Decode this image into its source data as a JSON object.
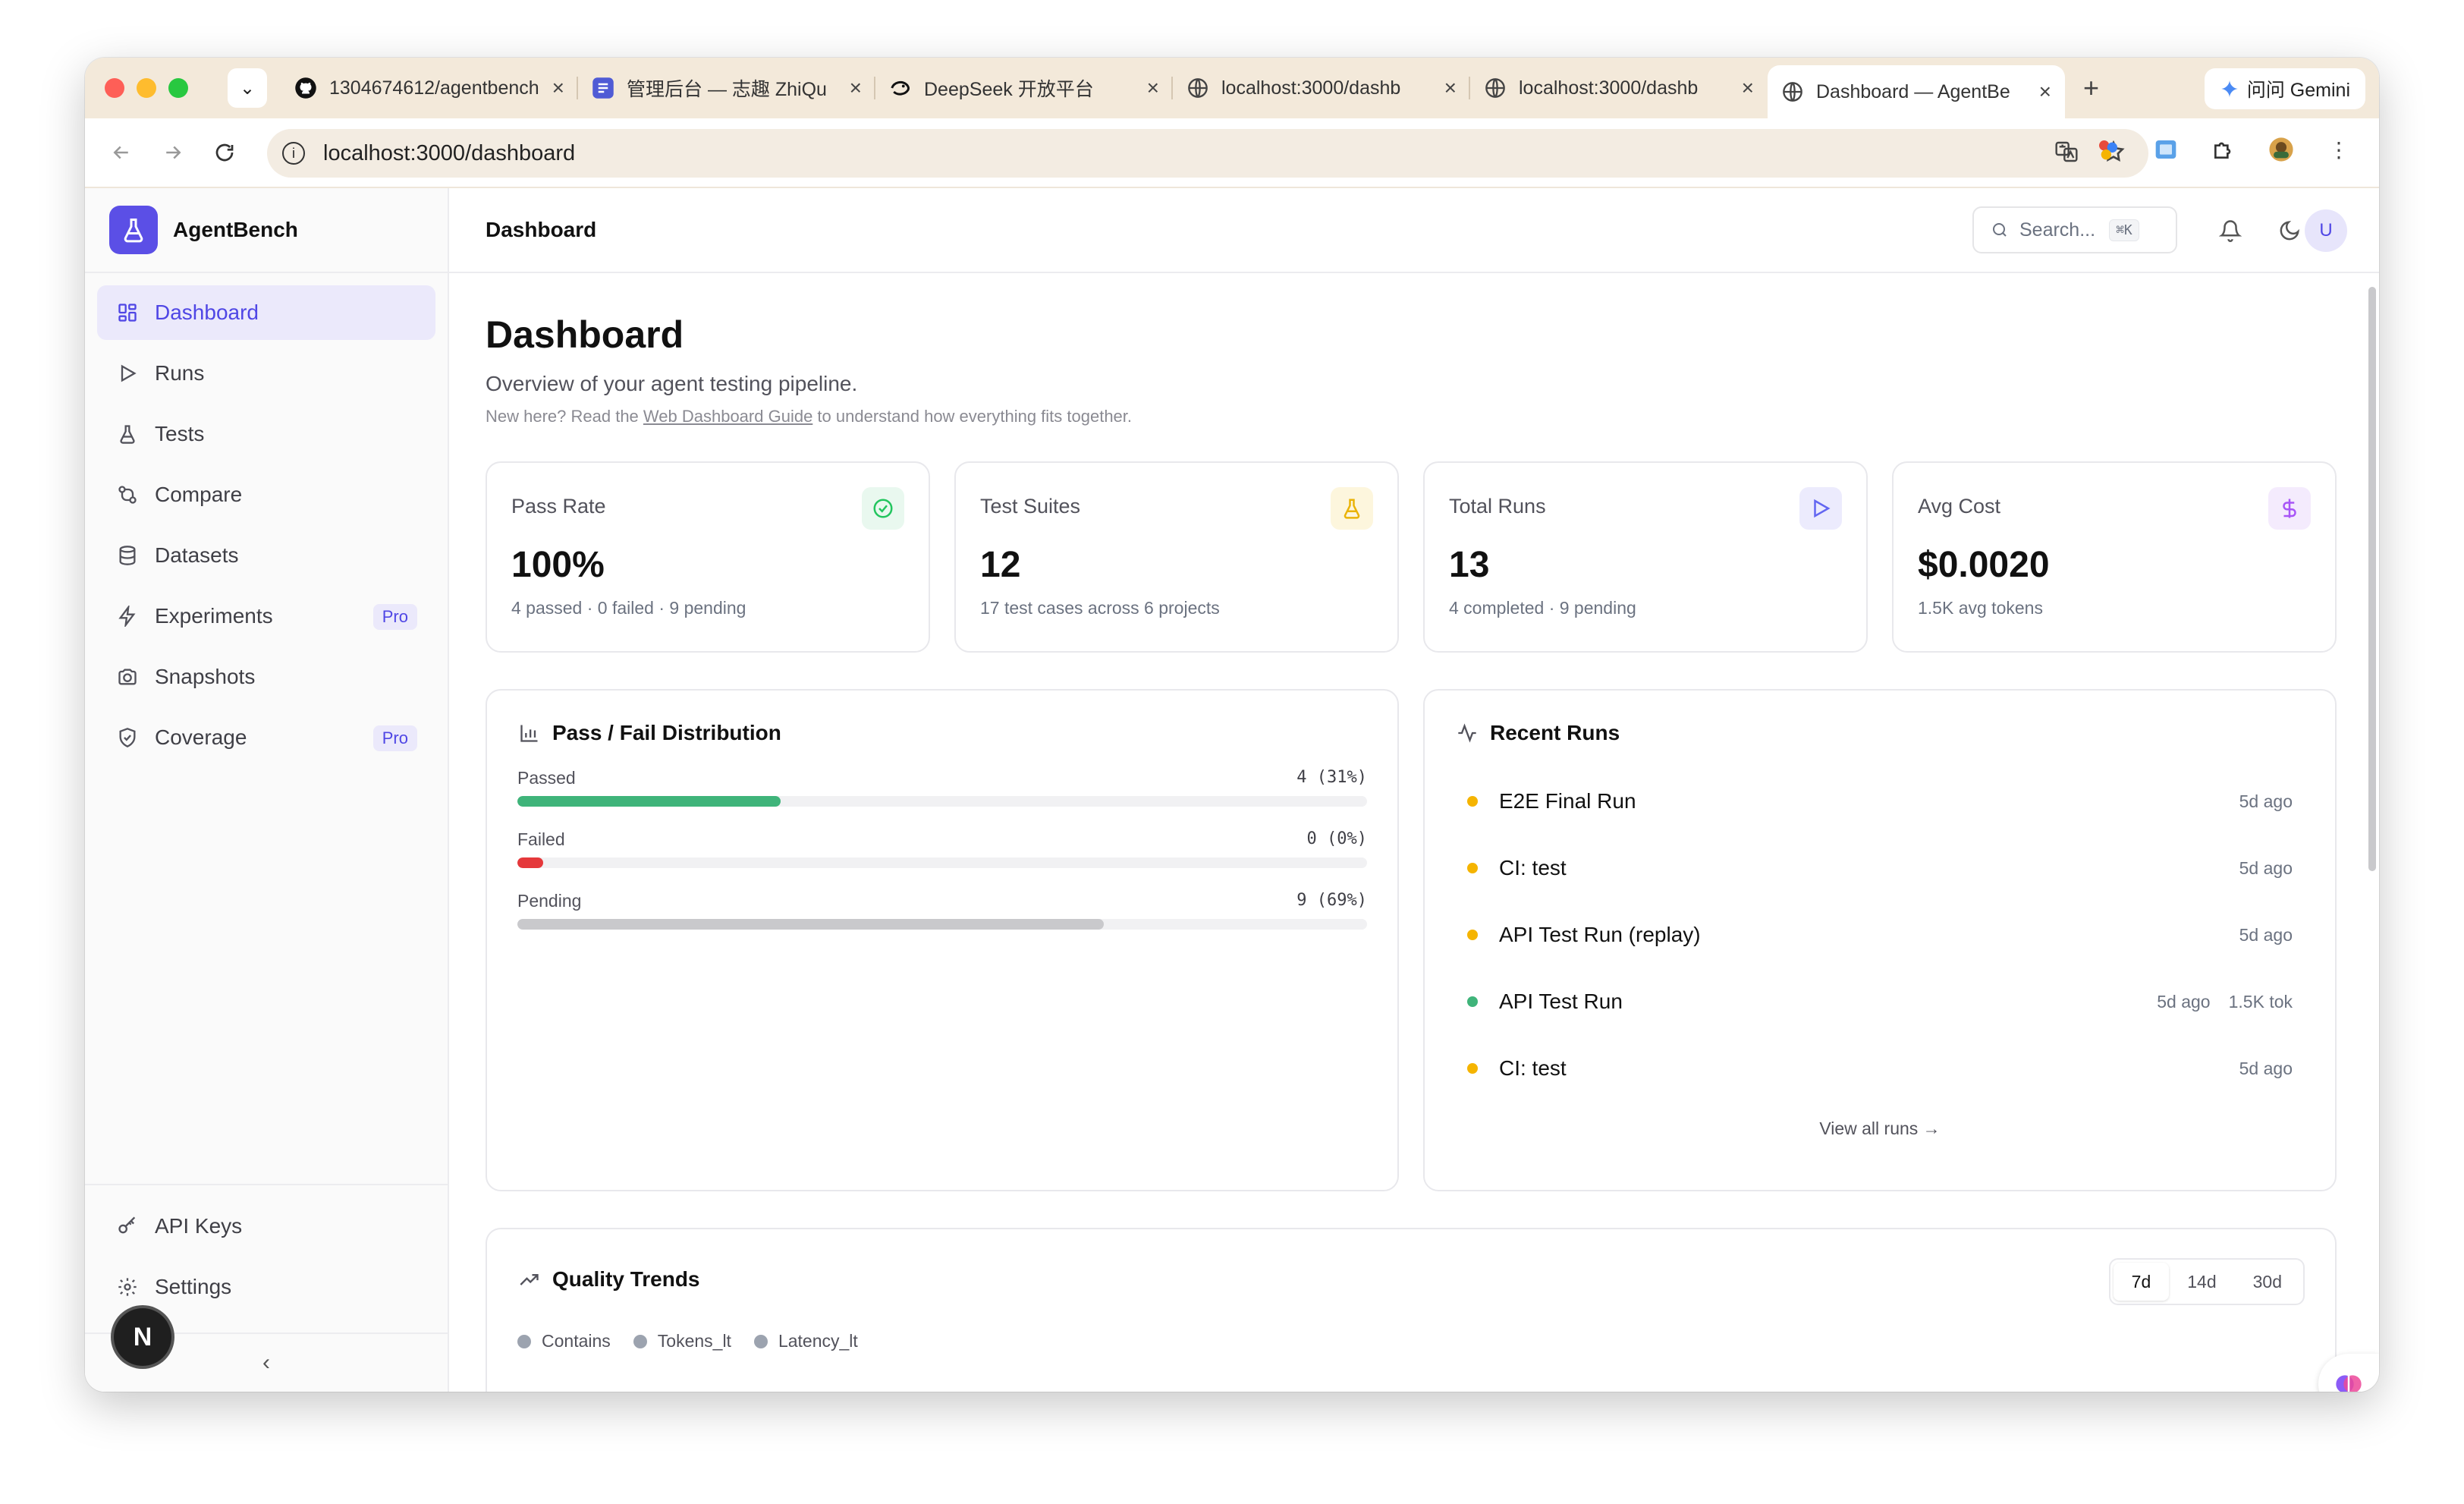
{
  "browser": {
    "tabs": [
      {
        "label": "1304674612/agentbench",
        "icon": "github-icon"
      },
      {
        "label": "管理后台 — 志趣 ZhiQu",
        "icon": "app-icon"
      },
      {
        "label": "DeepSeek 开放平台",
        "icon": "deepseek-icon"
      },
      {
        "label": "localhost:3000/dashb",
        "icon": "globe-icon"
      },
      {
        "label": "localhost:3000/dashb",
        "icon": "globe-icon"
      },
      {
        "label": "Dashboard — AgentBe",
        "icon": "globe-icon",
        "active": true
      }
    ],
    "gemini_label": "问问 Gemini",
    "url": "localhost:3000/dashboard"
  },
  "app": {
    "brand": "AgentBench",
    "accent": "#4f46e5",
    "nav": [
      {
        "label": "Dashboard",
        "icon": "dashboard-icon",
        "active": true
      },
      {
        "label": "Runs",
        "icon": "play-icon"
      },
      {
        "label": "Tests",
        "icon": "flask-icon"
      },
      {
        "label": "Compare",
        "icon": "compare-icon"
      },
      {
        "label": "Datasets",
        "icon": "database-icon"
      },
      {
        "label": "Experiments",
        "icon": "zap-icon",
        "badge": "Pro"
      },
      {
        "label": "Snapshots",
        "icon": "camera-icon"
      },
      {
        "label": "Coverage",
        "icon": "shield-icon",
        "badge": "Pro"
      }
    ],
    "bottom_nav": [
      {
        "label": "API Keys",
        "icon": "key-icon"
      },
      {
        "label": "Settings",
        "icon": "gear-icon"
      }
    ],
    "nextjs_badge": "N",
    "topbar": {
      "title": "Dashboard",
      "search_placeholder": "Search...",
      "search_shortcut": "⌘K",
      "avatar": "U"
    }
  },
  "page": {
    "title": "Dashboard",
    "subtitle": "Overview of your agent testing pipeline.",
    "hint_prefix": "New here? Read the ",
    "hint_link": "Web Dashboard Guide",
    "hint_suffix": " to understand how everything fits together."
  },
  "stats": [
    {
      "label": "Pass Rate",
      "value": "100%",
      "desc": "4 passed · 0 failed · 9 pending",
      "icon": "check-circle-icon",
      "color": "#22c55e",
      "bg": "#e9f8ef"
    },
    {
      "label": "Test Suites",
      "value": "12",
      "desc": "17 test cases across 6 projects",
      "icon": "flask-icon",
      "color": "#eab308",
      "bg": "#fdf6dd"
    },
    {
      "label": "Total Runs",
      "value": "13",
      "desc": "4 completed · 9 pending",
      "icon": "play-icon",
      "color": "#6366f1",
      "bg": "#ecebfd"
    },
    {
      "label": "Avg Cost",
      "value": "$0.0020",
      "desc": "1.5K avg tokens",
      "icon": "dollar-icon",
      "color": "#a855f7",
      "bg": "#f4ebfd"
    }
  ],
  "distribution": {
    "title": "Pass / Fail Distribution",
    "rows": [
      {
        "label": "Passed",
        "count": "4",
        "pct_label": "(31%)",
        "fraction": 0.31,
        "color": "#3fb47a"
      },
      {
        "label": "Failed",
        "count": "0",
        "pct_label": "(0%)",
        "fraction": 0.0,
        "color": "#e5383b"
      },
      {
        "label": "Pending",
        "count": "9",
        "pct_label": "(69%)",
        "fraction": 0.69,
        "color": "#c9c9cc"
      }
    ]
  },
  "recent_runs": {
    "title": "Recent Runs",
    "items": [
      {
        "name": "E2E Final Run",
        "time": "5d ago",
        "tokens": "",
        "status_color": "#f5b400"
      },
      {
        "name": "CI: test",
        "time": "5d ago",
        "tokens": "",
        "status_color": "#f5b400"
      },
      {
        "name": "API Test Run (replay)",
        "time": "5d ago",
        "tokens": "",
        "status_color": "#f5b400"
      },
      {
        "name": "API Test Run",
        "time": "5d ago",
        "tokens": "1.5K tok",
        "status_color": "#3fb47a"
      },
      {
        "name": "CI: test",
        "time": "5d ago",
        "tokens": "",
        "status_color": "#f5b400"
      }
    ],
    "view_all": "View all runs →"
  },
  "trends": {
    "title": "Quality Trends",
    "ranges": [
      "7d",
      "14d",
      "30d"
    ],
    "active_range": "7d",
    "legend": [
      "Contains",
      "Tokens_lt",
      "Latency_lt"
    ]
  }
}
